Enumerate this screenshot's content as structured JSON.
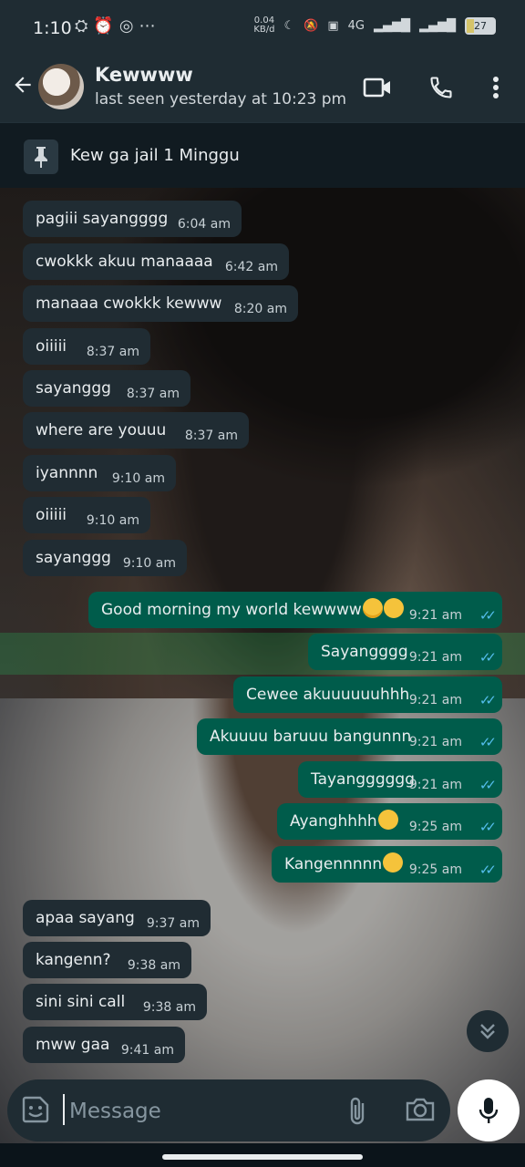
{
  "status_bar": {
    "time": "1:10",
    "left_icons": [
      "game-icon",
      "alarm-icon",
      "whatsapp-icon",
      "more-dots"
    ],
    "speed_value": "0.04",
    "speed_unit": "KB/d",
    "network": "4G",
    "battery": "27"
  },
  "header": {
    "contact_name": "Kewwww",
    "contact_status": "last seen yesterday at 10:23 pm"
  },
  "pinned": {
    "text": "Kew ga jail 1 Minggu"
  },
  "messages": [
    {
      "dir": "in",
      "text": "pagiii sayangggg",
      "time": "6:04 am"
    },
    {
      "dir": "in",
      "text": "cwokkk akuu manaaaa",
      "time": "6:42 am"
    },
    {
      "dir": "in",
      "text": "manaaa cwokkk kewww",
      "time": "8:20 am"
    },
    {
      "dir": "in",
      "text": "oiiiii",
      "time": "8:37 am"
    },
    {
      "dir": "in",
      "text": "sayanggg",
      "time": "8:37 am"
    },
    {
      "dir": "in",
      "text": "where are youuu",
      "time": "8:37 am"
    },
    {
      "dir": "in",
      "text": "iyannnn",
      "time": "9:10 am"
    },
    {
      "dir": "in",
      "text": "oiiiii",
      "time": "9:10 am"
    },
    {
      "dir": "in",
      "text": "sayanggg",
      "time": "9:10 am"
    },
    {
      "dir": "out",
      "text": "Good morning my world kewwww",
      "time": "9:21 am",
      "emoji": [
        "smiling-face-with-halo",
        "smiling-face-with-hearts"
      ]
    },
    {
      "dir": "out",
      "text": "Sayangggg",
      "time": "9:21 am"
    },
    {
      "dir": "out",
      "text": "Cewee akuuuuuuhhh",
      "time": "9:21 am"
    },
    {
      "dir": "out",
      "text": "Akuuuu baruuu bangunnn",
      "time": "9:21 am"
    },
    {
      "dir": "out",
      "text": "Tayangggggg",
      "time": "9:21 am"
    },
    {
      "dir": "out",
      "text": "Ayanghhhh",
      "time": "9:25 am",
      "emoji": [
        "loudly-crying-face"
      ]
    },
    {
      "dir": "out",
      "text": "Kangennnnn",
      "time": "9:25 am",
      "emoji": [
        "confounded-face"
      ]
    },
    {
      "dir": "in",
      "text": "apaa sayang",
      "time": "9:37 am"
    },
    {
      "dir": "in",
      "text": "kangenn?",
      "time": "9:38 am"
    },
    {
      "dir": "in",
      "text": "sini sini call",
      "time": "9:38 am"
    },
    {
      "dir": "in",
      "text": "mww gaa",
      "time": "9:41 am"
    }
  ],
  "composer": {
    "placeholder": "Message"
  },
  "colors": {
    "incoming_bubble": "#202c33",
    "outgoing_bubble": "#005c4b",
    "read_ticks": "#53bdeb",
    "header_bg": "#1f2c33"
  }
}
